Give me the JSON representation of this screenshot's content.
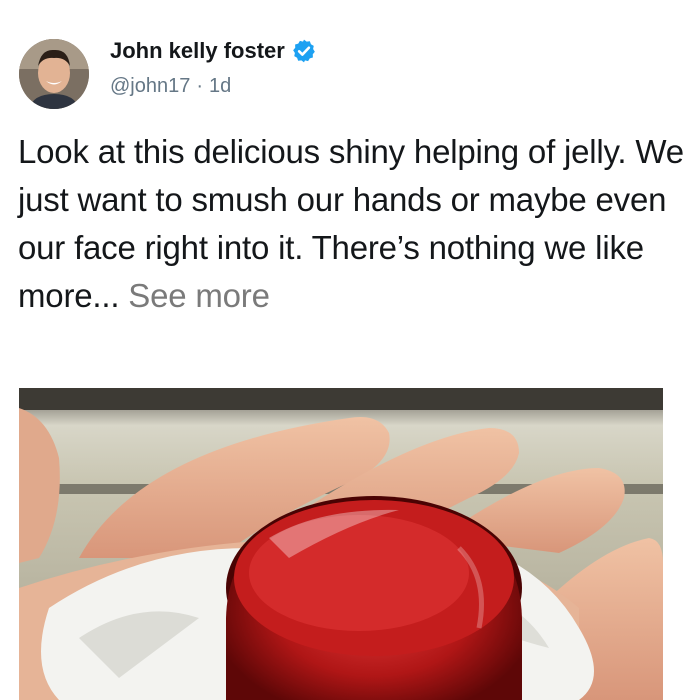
{
  "author": {
    "name": "John kelly foster",
    "handle": "@john17",
    "separator": "·",
    "time": "1d",
    "verified": true,
    "avatar_icon": "profile-photo"
  },
  "tweet": {
    "text": "Look at this delicious shiny helping of jelly. We just want to smush our hands or maybe even our face right into it. There’s nothing we like more...",
    "see_more": "See more"
  },
  "media": {
    "type": "photo",
    "subject": "red jelly on hand"
  },
  "colors": {
    "verified_blue": "#1da1f2",
    "secondary_text": "#657786",
    "see_more": "#7a7a7a"
  }
}
